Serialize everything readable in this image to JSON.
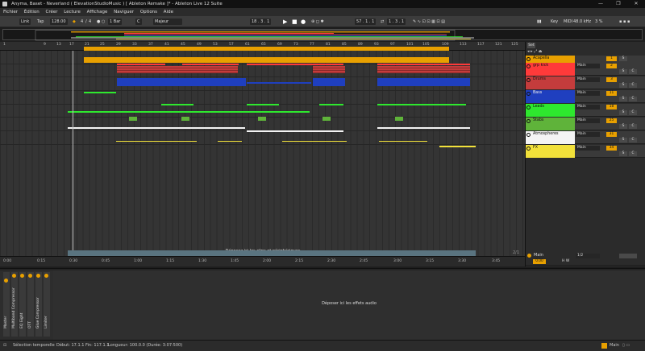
{
  "window": {
    "title": "Anyma, Baset - Neverland ( ElevationStudioMusic ) [ Ableton Remake ]* - Ableton Live 12 Suite",
    "controls": [
      "—",
      "❐",
      "✕"
    ]
  },
  "menu": [
    "Fichier",
    "Édition",
    "Créer",
    "Lecture",
    "Affichage",
    "Naviguer",
    "Options",
    "Aide"
  ],
  "transport": {
    "link": "Link",
    "tap": "Tap",
    "tempo": "128.00",
    "meter_num": "4",
    "meter_den": "4",
    "quantize": "1 Bar",
    "key": "C",
    "scale": "Majeur",
    "position": "18 . 3 . 1",
    "loop_start": "57 . 1 . 1",
    "loop_length": "1 . 3 . 1",
    "key_btn": "Key",
    "midi": "MIDI",
    "sample_rate": "48.0 kHz",
    "cpu": "3 %"
  },
  "bar_numbers": [
    "1",
    "9",
    "13",
    "17",
    "21",
    "25",
    "29",
    "33",
    "37",
    "41",
    "45",
    "49",
    "53",
    "57",
    "61",
    "65",
    "69",
    "73",
    "77",
    "81",
    "85",
    "89",
    "93",
    "97",
    "101",
    "105",
    "109",
    "113",
    "117",
    "121",
    "125"
  ],
  "time_labels": [
    "0:00",
    "0:15",
    "0:30",
    "0:45",
    "1:00",
    "1:15",
    "1:30",
    "1:45",
    "2:00",
    "2:15",
    "2:30",
    "2:45",
    "3:00",
    "3:15",
    "3:30",
    "3:45"
  ],
  "drop_clips_text": "Déposez ici les clips et périphériques",
  "zoom_label": "2/1",
  "set_label": "Set",
  "tracks": [
    {
      "name": "Acapella",
      "color": "#e8a000",
      "route": "",
      "num": "1",
      "s": "S"
    },
    {
      "name": "grp kick",
      "color": "#ff3a3a",
      "route": "Main",
      "num": "2",
      "s": "S",
      "c": "C"
    },
    {
      "name": "Drums",
      "color": "#c43c3c",
      "route": "Main",
      "num": "3",
      "s": "S",
      "c": "C"
    },
    {
      "name": "Bass",
      "color": "#1f3fbf",
      "route": "Main",
      "num": "11",
      "s": "S",
      "c": "C"
    },
    {
      "name": "Leads",
      "color": "#2ee82e",
      "route": "Main",
      "num": "18",
      "s": "S",
      "c": "C"
    },
    {
      "name": "Stabs",
      "color": "#5fb33a",
      "route": "Main",
      "num": "25",
      "s": "S",
      "c": "C"
    },
    {
      "name": "Atmospheres",
      "color": "#f4f4f4",
      "route": "Main",
      "num": "31",
      "s": "S",
      "c": "C"
    },
    {
      "name": "FX",
      "color": "#f2e13a",
      "route": "Main",
      "num": "34",
      "s": "S",
      "c": "C"
    }
  ],
  "main": {
    "name": "Main",
    "route": "1/2",
    "value": "0.00"
  },
  "devices": [
    "Master",
    "Multiband Compressor",
    "EQ Eight",
    "OTT",
    "Glue Compressor",
    "Limiter"
  ],
  "drop_effects_text": "Déposer ici les effets audio",
  "status": {
    "selection": "Sélection temporelle",
    "start": "Début: 17.1.1",
    "end": "Fin: 117.1.1",
    "length": "Longueur: 100.0.0 (Durée: 3:07:500)",
    "track": "Main"
  }
}
